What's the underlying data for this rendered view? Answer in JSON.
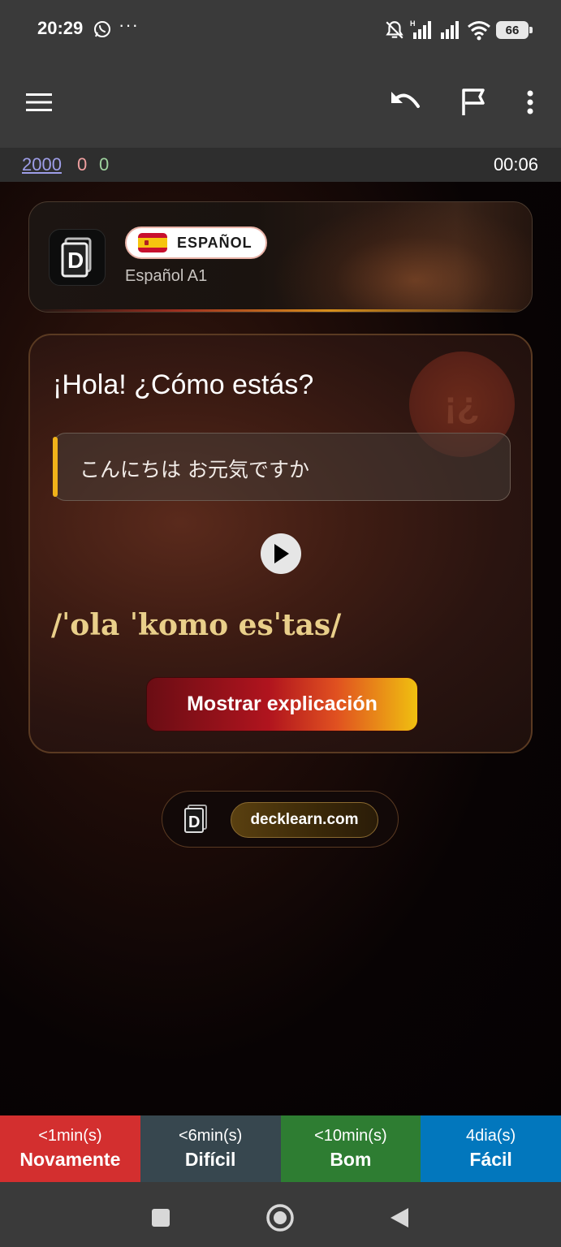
{
  "status_bar": {
    "time": "20:29",
    "battery": "66",
    "icons": [
      "whatsapp-icon",
      "more-icon",
      "mute-icon",
      "signal-icon",
      "wifi-icon",
      "battery-icon"
    ]
  },
  "toolbar": {
    "icons": [
      "menu-icon",
      "undo-icon",
      "flag-icon",
      "more-vert-icon"
    ]
  },
  "counts": {
    "new": "2000",
    "learn": "0",
    "review": "0",
    "timer": "00:06"
  },
  "header": {
    "language": "ESPAÑOL",
    "deck_name": "Español A1"
  },
  "card": {
    "question": "¡Hola! ¿Cómo estás?",
    "badge": "¡¿",
    "translation": "こんにちは お元気ですか",
    "ipa": "/ˈola ˈkomo esˈtas/",
    "explain_button": "Mostrar explicación"
  },
  "footer": {
    "site": "decklearn.com"
  },
  "answers": [
    {
      "interval": "<1min(s)",
      "label": "Novamente",
      "color": "#d32f2f"
    },
    {
      "interval": "<6min(s)",
      "label": "Difícil",
      "color": "#37474f"
    },
    {
      "interval": "<10min(s)",
      "label": "Bom",
      "color": "#2e7d32"
    },
    {
      "interval": "4dia(s)",
      "label": "Fácil",
      "color": "#0277bd"
    }
  ],
  "colors": {
    "accent": "#f0b21a",
    "ipa": "#e9cf8a",
    "new_count": "#9e9ee8",
    "learn_count": "#f0a0a0",
    "review_count": "#9ed29e"
  }
}
